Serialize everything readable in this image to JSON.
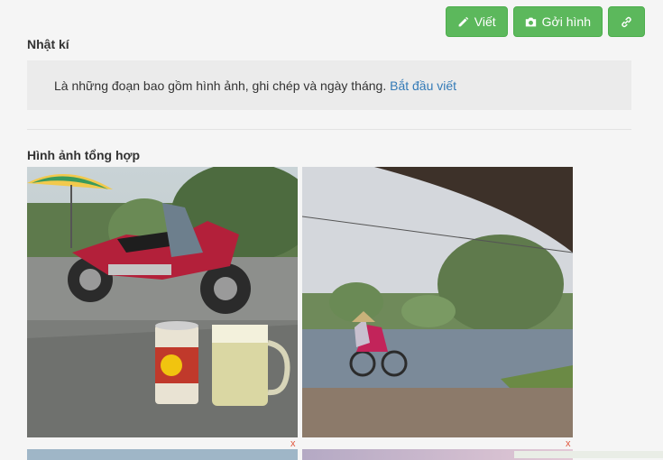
{
  "toolbar": {
    "write_label": "Viết",
    "send_photo_label": "Gởi hình"
  },
  "diary": {
    "title": "Nhật kí",
    "description": "Là những đoạn bao gồm hình ảnh, ghi chép và ngày tháng.",
    "start_link": "Bắt đầu viết"
  },
  "gallery": {
    "title": "Hình ảnh tổng hợp",
    "remove_label": "x"
  },
  "icons": {
    "write": "pencil-icon",
    "send_photo": "camera-icon",
    "link": "link-icon"
  },
  "colors": {
    "button": "#5cb85c",
    "link": "#337ab7",
    "remove": "#e0563d"
  }
}
